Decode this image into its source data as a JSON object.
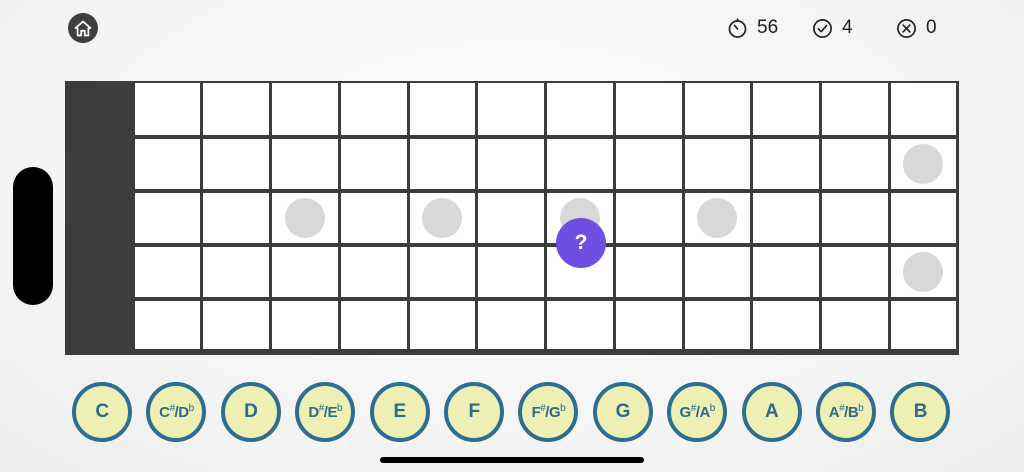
{
  "header": {
    "home_icon": "home-icon",
    "timer": {
      "icon": "stopwatch-icon",
      "value": "56"
    },
    "correct": {
      "icon": "check-circle-icon",
      "value": "4"
    },
    "wrong": {
      "icon": "x-circle-icon",
      "value": "0"
    }
  },
  "fretboard": {
    "strings": 5,
    "frets": 12,
    "markers": [
      {
        "string": 3,
        "fret": 3
      },
      {
        "string": 3,
        "fret": 5
      },
      {
        "string": 3,
        "fret": 7
      },
      {
        "string": 3,
        "fret": 9
      },
      {
        "string": 2,
        "fret": 12
      },
      {
        "string": 4,
        "fret": 12
      }
    ],
    "question_mark": "?",
    "colors": {
      "board": "#3b3d3b",
      "cell": "#ffffff",
      "marker": "#d8d8d8",
      "question": "#6f4fe3"
    }
  },
  "notes": [
    {
      "base": "C"
    },
    {
      "base": "C",
      "acc": "#",
      "alt": "D",
      "alt_acc": "b"
    },
    {
      "base": "D"
    },
    {
      "base": "D",
      "acc": "#",
      "alt": "E",
      "alt_acc": "b"
    },
    {
      "base": "E"
    },
    {
      "base": "F"
    },
    {
      "base": "F",
      "acc": "#",
      "alt": "G",
      "alt_acc": "b"
    },
    {
      "base": "G"
    },
    {
      "base": "G",
      "acc": "#",
      "alt": "A",
      "alt_acc": "b"
    },
    {
      "base": "A"
    },
    {
      "base": "A",
      "acc": "#",
      "alt": "B",
      "alt_acc": "b"
    },
    {
      "base": "B"
    }
  ],
  "note_colors": {
    "fill": "#eef0b3",
    "ring": "#2d6e92",
    "text": "#2c6a8c"
  }
}
